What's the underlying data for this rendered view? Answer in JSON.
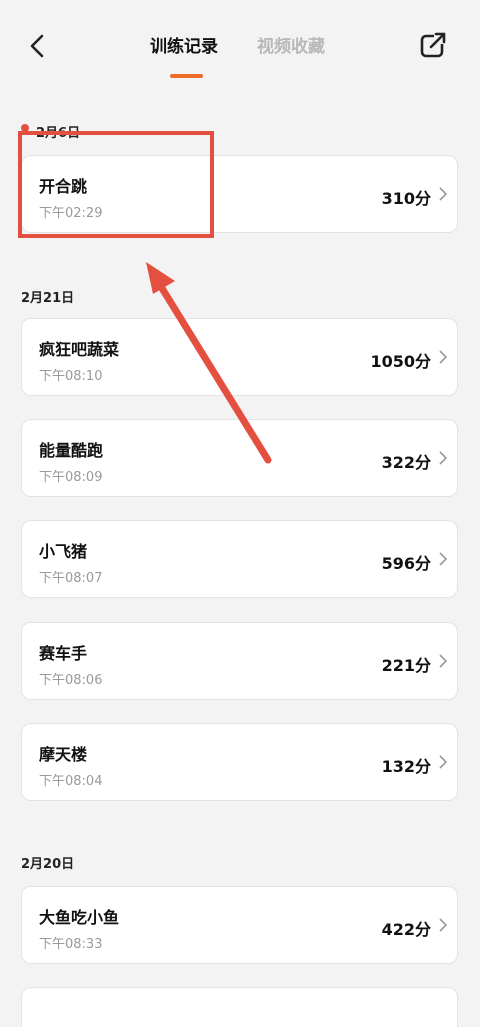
{
  "header": {
    "tabs": [
      {
        "label": "训练记录"
      },
      {
        "label": "视频收藏"
      }
    ]
  },
  "colors": {
    "accent": "#ee6b2a",
    "annotation": "#e4503f",
    "background": "#f3f3f3"
  },
  "icons": {
    "back": "chevron-left-icon",
    "share": "share-external-icon",
    "row": "chevron-right-icon"
  },
  "sections": [
    {
      "date": "2月6日",
      "records": [
        {
          "name": "开合跳",
          "time": "下午02:29",
          "score": "310分"
        }
      ]
    },
    {
      "date": "2月21日",
      "records": [
        {
          "name": "疯狂吧蔬菜",
          "time": "下午08:10",
          "score": "1050分"
        },
        {
          "name": "能量酷跑",
          "time": "下午08:09",
          "score": "322分"
        },
        {
          "name": "小飞猪",
          "time": "下午08:07",
          "score": "596分"
        },
        {
          "name": "赛车手",
          "time": "下午08:06",
          "score": "221分"
        },
        {
          "name": "摩天楼",
          "time": "下午08:04",
          "score": "132分"
        }
      ]
    },
    {
      "date": "2月20日",
      "records": [
        {
          "name": "大鱼吃小鱼",
          "time": "下午08:33",
          "score": "422分"
        }
      ]
    }
  ]
}
